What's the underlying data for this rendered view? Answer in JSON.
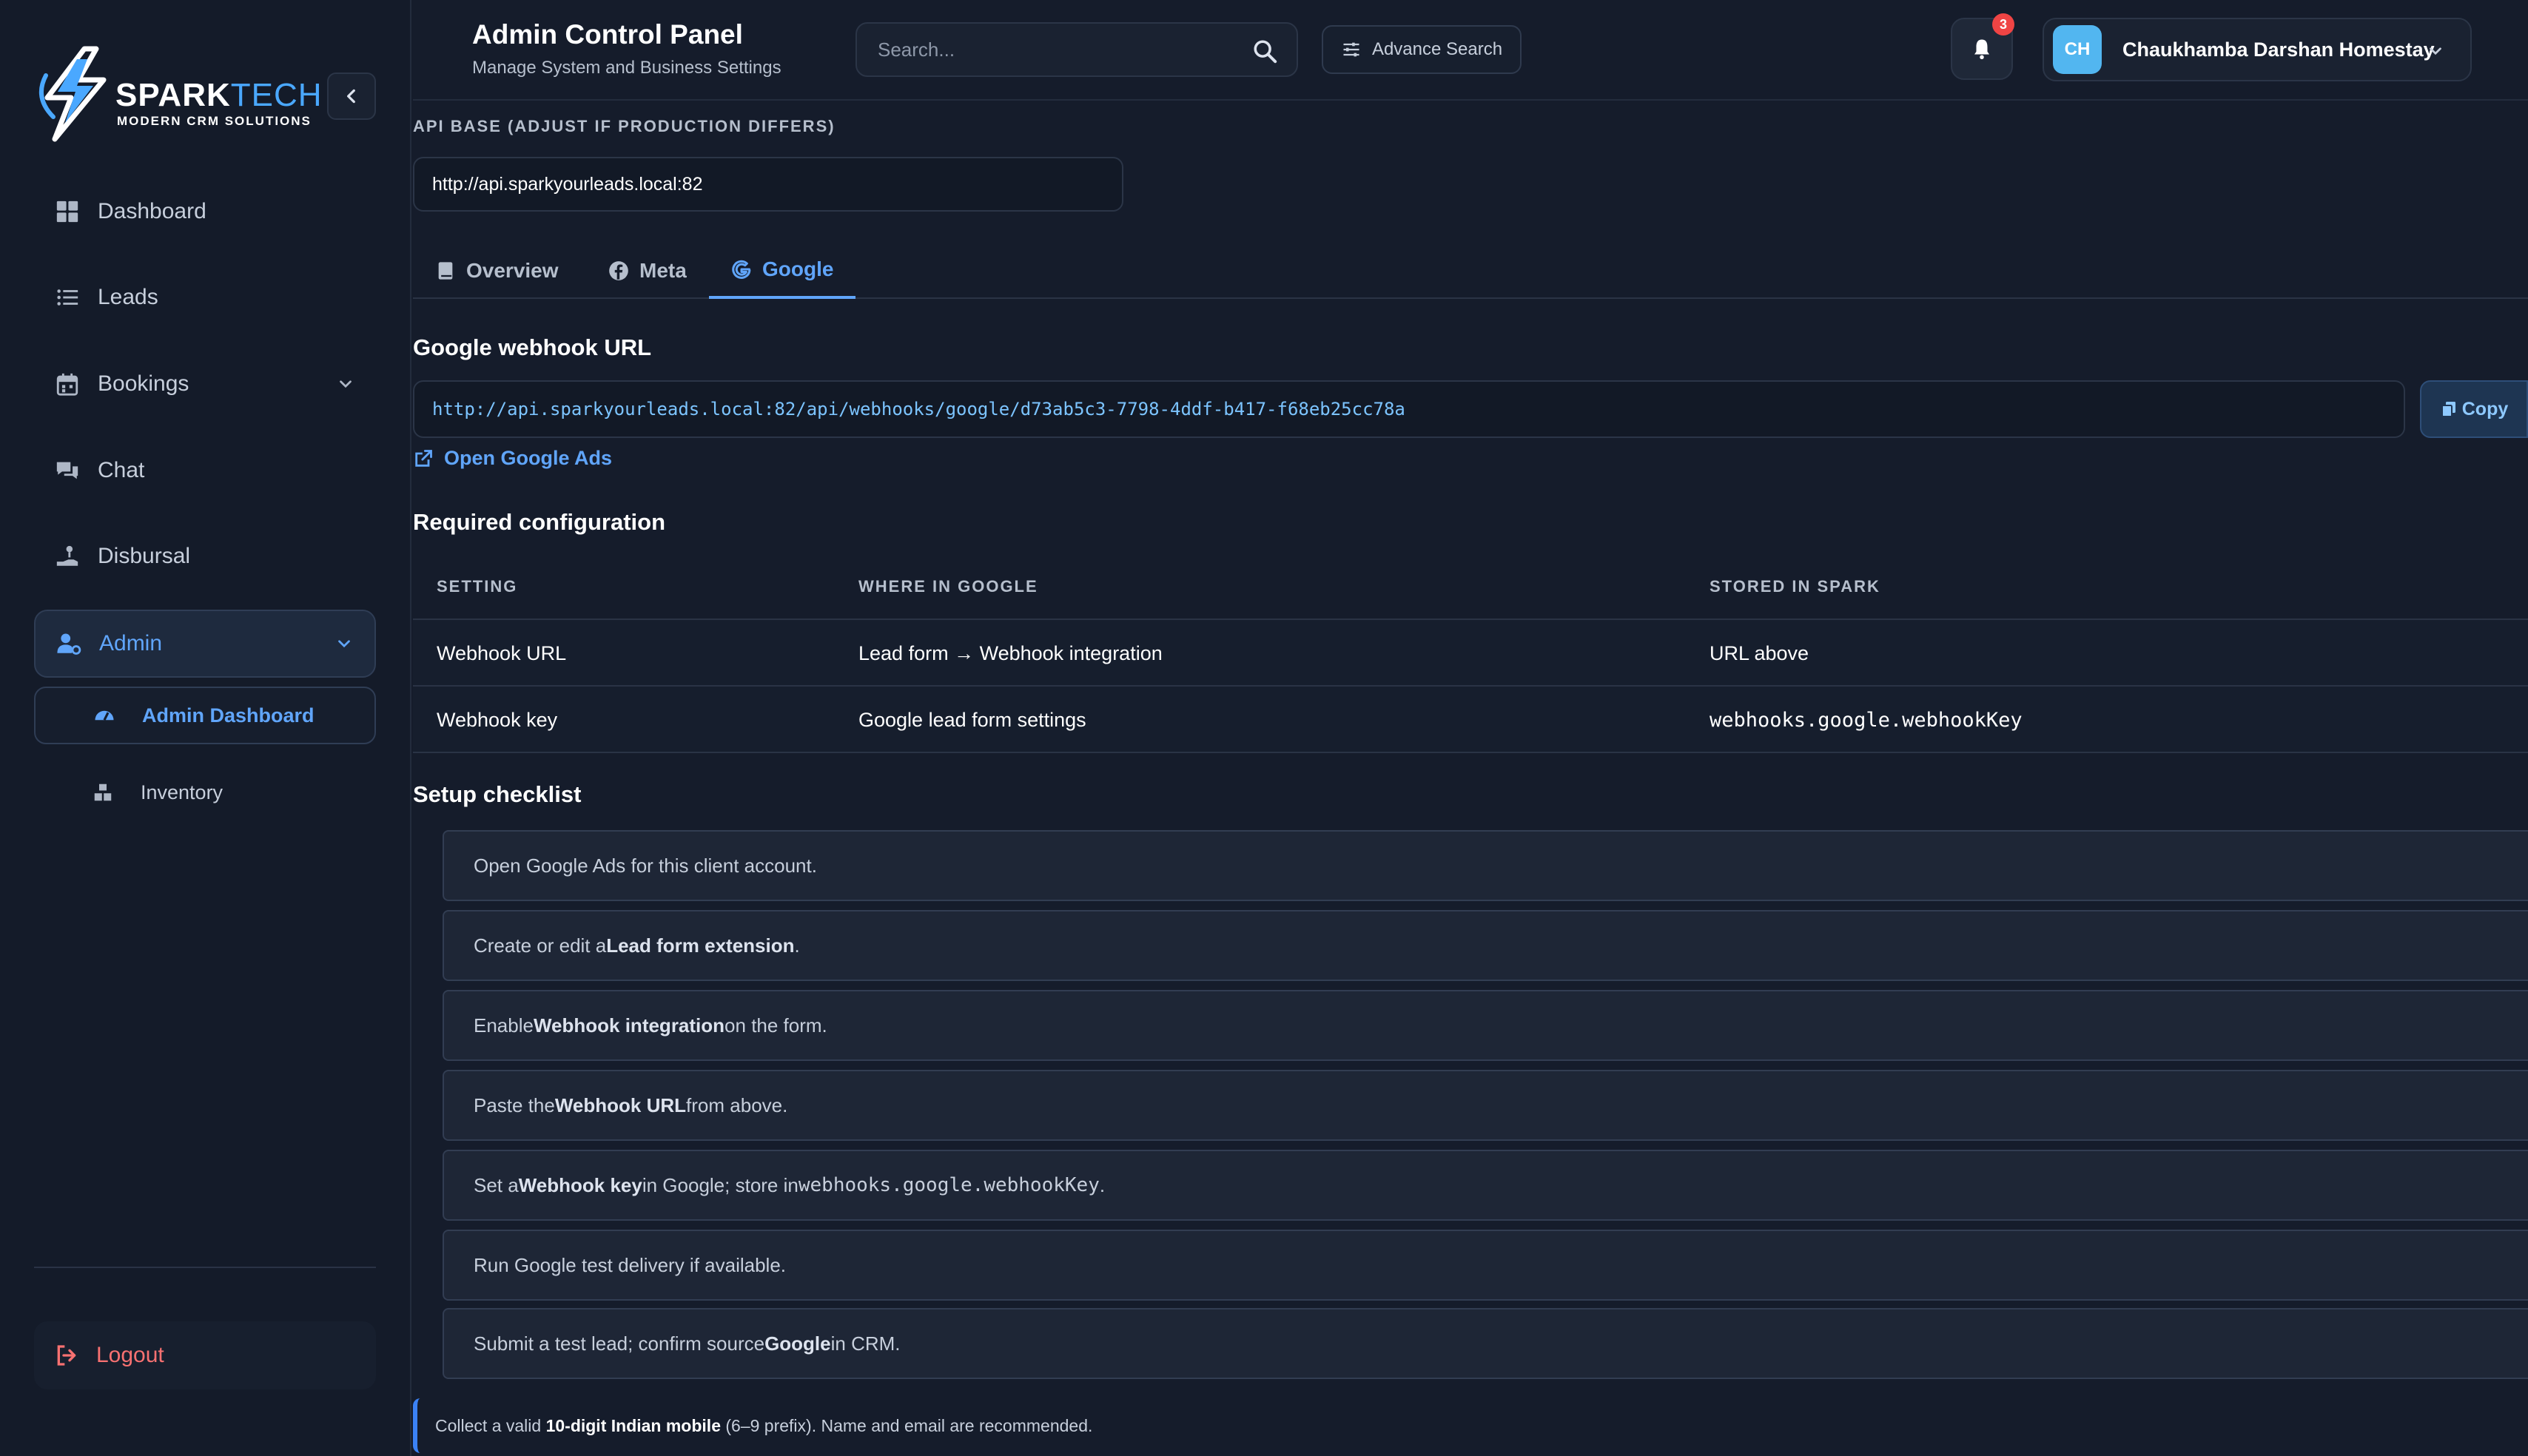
{
  "brand": {
    "name_part1": "SPARK",
    "name_part2": "TECH",
    "tagline": "MODERN CRM SOLUTIONS",
    "accent_color": "#4aa8ff"
  },
  "sidebar": {
    "items": [
      {
        "label": "Dashboard",
        "icon": "grid-icon"
      },
      {
        "label": "Leads",
        "icon": "list-icon"
      },
      {
        "label": "Bookings",
        "icon": "calendar-icon"
      },
      {
        "label": "Chat",
        "icon": "chat-icon"
      },
      {
        "label": "Disbursal",
        "icon": "hand-coin-icon"
      },
      {
        "label": "Admin",
        "icon": "user-gear-icon",
        "active": true
      }
    ],
    "sub_items": [
      {
        "label": "Admin Dashboard",
        "icon": "gauge-icon",
        "active": true
      },
      {
        "label": "Inventory",
        "icon": "boxes-icon"
      }
    ],
    "logout_label": "Logout"
  },
  "header": {
    "title": "Admin Control Panel",
    "subtitle": "Manage System and Business Settings",
    "search_placeholder": "Search...",
    "advance_search_label": "Advance Search",
    "notification_count": "3",
    "user_initials": "CH",
    "user_name": "Chaukhamba Darshan Homestay"
  },
  "api": {
    "label": "API BASE (ADJUST IF PRODUCTION DIFFERS)",
    "value": "http://api.sparkyourleads.local:82"
  },
  "tabs": [
    {
      "label": "Overview",
      "icon": "book-icon"
    },
    {
      "label": "Meta",
      "icon": "facebook-icon"
    },
    {
      "label": "Google",
      "icon": "google-icon",
      "active": true
    }
  ],
  "webhook": {
    "title": "Google webhook URL",
    "url": "http://api.sparkyourleads.local:82/api/webhooks/google/d73ab5c3-7798-4ddf-b417-f68eb25cc78a",
    "copy_label": "Copy",
    "open_link_label": "Open Google Ads"
  },
  "config": {
    "title": "Required configuration",
    "headers": [
      "SETTING",
      "WHERE IN GOOGLE",
      "STORED IN SPARK"
    ],
    "rows": [
      [
        "Webhook URL",
        "Lead form → Webhook integration",
        "URL above"
      ],
      [
        "Webhook key",
        "Google lead form settings",
        "webhooks.google.webhookKey"
      ]
    ]
  },
  "checklist": {
    "title": "Setup checklist",
    "items": [
      {
        "pre": "Open Google Ads for this client account.",
        "bold": "",
        "post": ""
      },
      {
        "pre": "Create or edit a",
        "bold": "Lead form extension",
        "post": "."
      },
      {
        "pre": "Enable",
        "bold": "Webhook integration",
        "post": "on the form."
      },
      {
        "pre": "Paste the",
        "bold": "Webhook URL",
        "post": "from above."
      },
      {
        "pre": "Set a",
        "bold": "Webhook key",
        "post": "in Google; store in",
        "code": "webhooks.google.webhookKey",
        "tail": "."
      },
      {
        "pre": "Run Google test delivery if available.",
        "bold": "",
        "post": ""
      },
      {
        "pre": "Submit a test lead; confirm source",
        "bold": "Google",
        "post": "in CRM."
      }
    ]
  },
  "note": {
    "pre": "Collect a valid ",
    "bold": "10-digit Indian mobile",
    "post": " (6–9 prefix). Name and email are recommended."
  }
}
